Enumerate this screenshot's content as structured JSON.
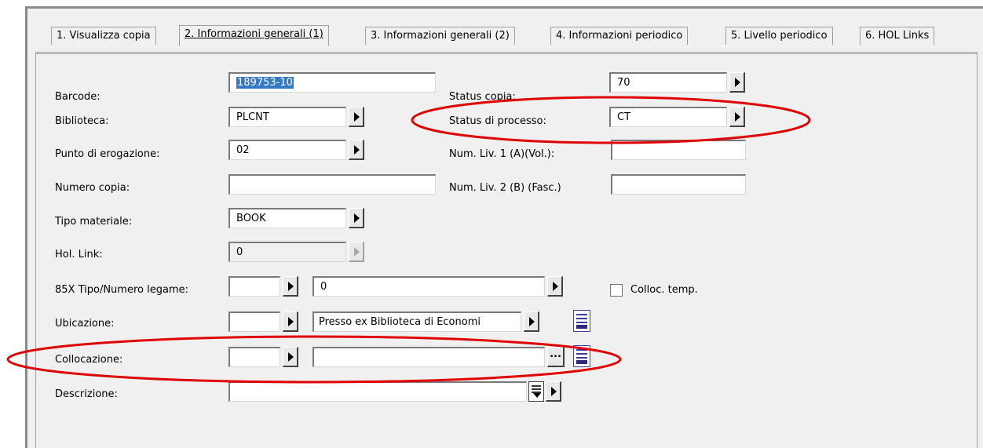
{
  "tabs": [
    {
      "label": "1. Visualizza copia"
    },
    {
      "label": "2. Informazioni generali (1)"
    },
    {
      "label": "3. Informazioni generali (2)"
    },
    {
      "label": "4. Informazioni periodico"
    },
    {
      "label": "5. Livello periodico"
    },
    {
      "label": "6. HOL Links"
    }
  ],
  "fields": {
    "barcode": {
      "label": "Barcode:",
      "value": "189753-10"
    },
    "biblioteca": {
      "label": "Biblioteca:",
      "value": "PLCNT"
    },
    "punto_erogazione": {
      "label": "Punto di erogazione:",
      "value": "02"
    },
    "numero_copia": {
      "label": "Numero copia:",
      "value": ""
    },
    "tipo_materiale": {
      "label": "Tipo materiale:",
      "value": "BOOK"
    },
    "hol_link": {
      "label": "Hol. Link:",
      "value": "0"
    },
    "tipo_numero_legame": {
      "label": "85X Tipo/Numero legame:",
      "value_type": "",
      "value_number": "0"
    },
    "ubicazione": {
      "label": "Ubicazione:",
      "value_code": "",
      "value_text": "Presso ex Biblioteca di Economi"
    },
    "collocazione": {
      "label": "Collocazione:",
      "value_code": "",
      "value_text": ""
    },
    "descrizione": {
      "label": "Descrizione:",
      "value": ""
    },
    "status_copia": {
      "label": "Status copia:",
      "value": "70"
    },
    "status_processo": {
      "label": "Status di processo:",
      "value": "CT"
    },
    "num_liv1": {
      "label": "Num. Liv. 1 (A)(Vol.):",
      "value": ""
    },
    "num_liv2": {
      "label": "Num. Liv. 2  (B) (Fasc.)",
      "value": ""
    },
    "colloc_temp": {
      "label": "Colloc. temp.",
      "checked": false
    }
  },
  "annotation_color": "#e00000"
}
